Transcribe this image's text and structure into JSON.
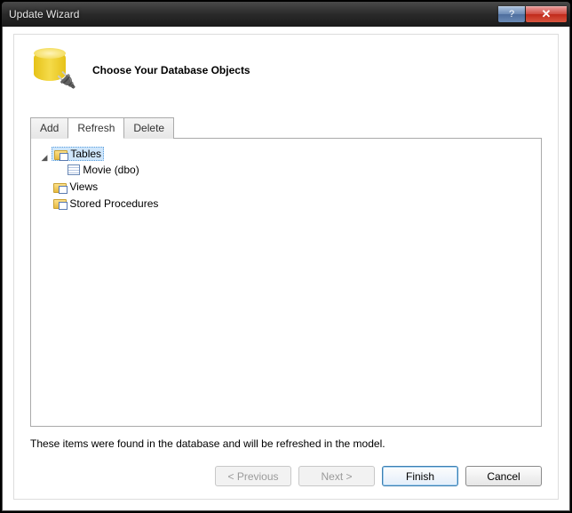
{
  "window": {
    "title": "Update Wizard"
  },
  "header": {
    "heading": "Choose Your Database Objects"
  },
  "tabs": {
    "add": "Add",
    "refresh": "Refresh",
    "delete": "Delete",
    "active": "Refresh"
  },
  "tree": {
    "tables": {
      "label": "Tables",
      "expanded": true
    },
    "movie": {
      "label": "Movie (dbo)"
    },
    "views": {
      "label": "Views"
    },
    "sprocs": {
      "label": "Stored Procedures"
    }
  },
  "info_text": "These items were found in the database and will be refreshed in the model.",
  "buttons": {
    "previous": "< Previous",
    "next": "Next >",
    "finish": "Finish",
    "cancel": "Cancel"
  }
}
